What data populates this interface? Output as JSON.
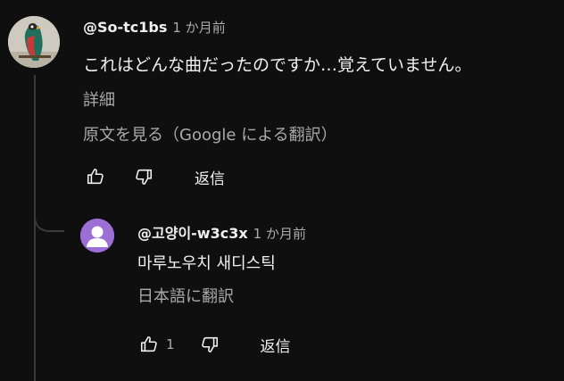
{
  "main_comment": {
    "author": "@So-tc1bs",
    "timestamp": "1 か月前",
    "text": "これはどんな曲だったのですか…覚えていません。",
    "read_more": "詳細",
    "translate": "原文を見る（Google による翻訳）",
    "like_icon": "thumb-up-icon",
    "dislike_icon": "thumb-down-icon",
    "reply_label": "返信"
  },
  "reply_comment": {
    "author": "@고양이-w3c3x",
    "timestamp": "1 か月前",
    "text": "마루노우치 새디스틱",
    "translate": "日本語に翻訳",
    "like_count": "1",
    "like_icon": "thumb-up-icon",
    "dislike_icon": "thumb-down-icon",
    "reply_label": "返信"
  },
  "colors": {
    "background": "#0f0f0f",
    "text_primary": "#f1f1f1",
    "text_secondary": "#aaaaaa",
    "thread_line": "#3a3a3a",
    "reply_avatar": "#9b6fd6"
  }
}
